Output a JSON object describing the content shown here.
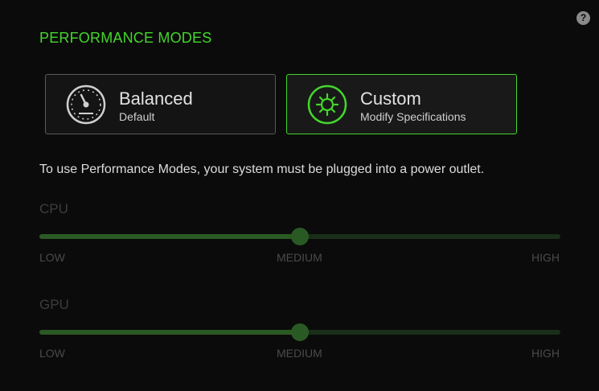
{
  "help": {
    "label": "?"
  },
  "header": {
    "title": "PERFORMANCE MODES"
  },
  "modes": [
    {
      "name": "Balanced",
      "subtitle": "Default",
      "icon": "speedometer-icon",
      "selected": false
    },
    {
      "name": "Custom",
      "subtitle": "Modify Specifications",
      "icon": "gear-icon",
      "selected": true
    }
  ],
  "notice": "To use Performance Modes, your system must be plugged into a power outlet.",
  "sliders": {
    "cpu": {
      "label": "CPU",
      "value": 0.5,
      "ticks": [
        "LOW",
        "MEDIUM",
        "HIGH"
      ]
    },
    "gpu": {
      "label": "GPU",
      "value": 0.5,
      "ticks": [
        "LOW",
        "MEDIUM",
        "HIGH"
      ]
    }
  },
  "colors": {
    "accent": "#44d62c",
    "background": "#0b0b0b",
    "disabled_track": "#1a2e19",
    "disabled_fill": "#2a5a24"
  }
}
